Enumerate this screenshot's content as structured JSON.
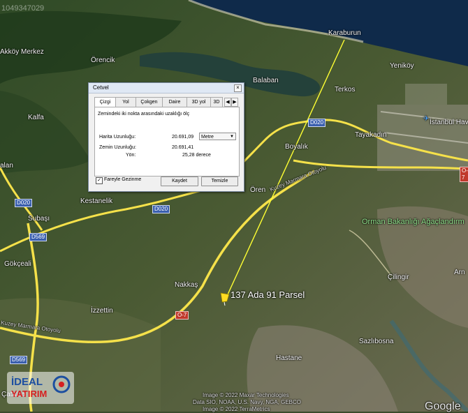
{
  "watermark": "1049347029",
  "map_labels": {
    "karaburun": "Karaburun",
    "yenikoy": "Yeniköy",
    "akkoy_merkez": "Akköy Merkez",
    "orencik": "Örencik",
    "balaban": "Balaban",
    "terkos": "Terkos",
    "kalfa": "Kalfa",
    "tayakadin": "Tayakadın",
    "istanbul_havalimani": "İstanbul Havalim",
    "boyalik": "Boyalık",
    "alan": "alan",
    "kestanelik": "Kestanelik",
    "oren": "Ören",
    "subasi": "Subaşı",
    "orman": "Orman Bakanlığı Ağaçlandırm",
    "gokceali": "Gökçeali",
    "nakkas": "Nakkaş",
    "cilingir": "Çilingir",
    "arn": "Arn",
    "izzettin": "İzzettin",
    "sazlibosna": "Sazlıbosna",
    "hastane": "Hastane",
    "catalca": "Çatalca",
    "marmara_road": "Kuzey Marmara Otoyolu",
    "marmara_road2": "Kuzey Marmara Otoyolu",
    "parcel": "137 Ada 91 Parsel",
    "google": "Google"
  },
  "shields": {
    "d020_a": "D020",
    "d020_b": "D020",
    "d020_c": "D020",
    "d569_a": "D569",
    "d569_b": "D569",
    "o7_a": "O-7",
    "o7_b": "O-7"
  },
  "credits": {
    "line1": "Image © 2022 Maxar Technologies",
    "line2": "Data SIO, NOAA, U.S. Navy, NGA, GEBCO",
    "line3": "Image © 2022 TerraMetrics"
  },
  "dialog": {
    "title": "Cetvel",
    "close": "×",
    "tabs": [
      "Çizgi",
      "Yol",
      "Çokgen",
      "Daire",
      "3D yol",
      "3D"
    ],
    "tab_prev": "◀",
    "tab_next": "▶",
    "description": "Zemindeki iki nokta arasındaki uzaklığı ölç",
    "map_length_label": "Harita Uzunluğu:",
    "map_length_value": "20.691,09",
    "unit": "Metre",
    "ground_length_label": "Zemin Uzunluğu:",
    "ground_length_value": "20.691,41",
    "heading_label": "Yön:",
    "heading_value": "25,28 derece",
    "mouse_nav_label": "Fareyle Gezinme",
    "mouse_nav_checked": "✓",
    "save_button": "Kaydet",
    "clear_button": "Temizle"
  },
  "logo": {
    "line1": "İDEAL",
    "line2": "YATIRIM"
  },
  "colors": {
    "road": "#f5e14a",
    "ruler": "#ffff33",
    "sea": "#0f2a4a"
  }
}
